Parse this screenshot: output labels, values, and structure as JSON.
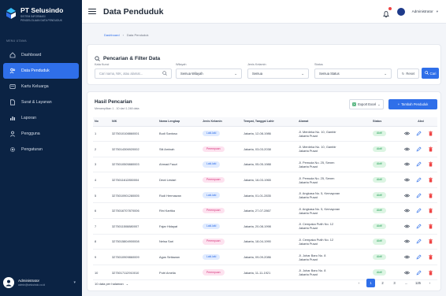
{
  "brand": {
    "title": "PT Selusindo",
    "subtitle_1": "SISTEM INFORMASI",
    "subtitle_2": "PENGELOLAAN DATA PENDUDUK"
  },
  "sidebar": {
    "section": "MENU UTAMA",
    "items": [
      {
        "label": "Dashboard",
        "icon": "home-icon"
      },
      {
        "label": "Data Penduduk",
        "icon": "users-icon"
      },
      {
        "label": "Kartu Keluarga",
        "icon": "card-icon"
      },
      {
        "label": "Surat & Layanan",
        "icon": "document-icon"
      },
      {
        "label": "Laporan",
        "icon": "bar-chart-icon"
      },
      {
        "label": "Pengguna",
        "icon": "user-icon"
      },
      {
        "label": "Pengaturan",
        "icon": "gear-icon"
      }
    ],
    "user_name": "Administrator",
    "user_email": "admin@selusindo.co.id"
  },
  "topbar": {
    "title": "Data Penduduk",
    "admin_label": "Administrator"
  },
  "breadcrumb": {
    "home": "Dashboard",
    "sep": "›",
    "current": "Data Penduduk"
  },
  "filter": {
    "title": "Pencarian & Filter Data",
    "label_search": "Kata Kunci",
    "label_wilayah": "Wilayah",
    "label_gender": "Jenis Kelamin",
    "label_status": "Status",
    "search_placeholder": "Cari nama, NIK, atau alamat...",
    "wilayah_value": "Semua Wilayah",
    "gender_value": "Semua",
    "status_value": "Semua Status",
    "reset_label": "Reset",
    "cari_label": "Cari"
  },
  "results": {
    "title": "Hasil Pencarian",
    "subtitle": "Menampilkan 1 - 10 dari 1.248 data",
    "export_label": "Export Excel",
    "add_label": "Tambah Penduduk",
    "columns": [
      "No",
      "NIK",
      "Nama Lengkap",
      "Jenis Kelamin",
      "Tempat, Tanggal Lahir",
      "Alamat",
      "Status",
      "Aksi"
    ],
    "rows": [
      {
        "no": "1",
        "nik": "3275010108860001",
        "nama": "Budi Santoso",
        "jk": "Laki-laki",
        "g": "m",
        "ttl": "Jakarta, 12-08-1986",
        "alamat1": "Jl. Merdeka No. 10, Gambir",
        "alamat2": "Jakarta Pusat",
        "status": "Aktif"
      },
      {
        "no": "2",
        "nik": "3275014306920002",
        "nama": "Siti Aminah",
        "jk": "Perempuan",
        "g": "f",
        "ttl": "Jakarta, 03-03-2038",
        "alamat1": "Jl. Merdeka No. 10, Gambir",
        "alamat2": "Jakarta Pusat",
        "status": "Aktif"
      },
      {
        "no": "3",
        "nik": "3275010505880003",
        "nama": "Ahmad Fauzi",
        "jk": "Laki-laki",
        "g": "m",
        "ttl": "Jakarta, 05-05-1988",
        "alamat1": "Jl. Pemuda No. 25, Senen",
        "alamat2": "Jakarta Pusat",
        "status": "Aktif"
      },
      {
        "no": "4",
        "nik": "3275011612850004",
        "nama": "Dewi Lestari",
        "jk": "Perempuan",
        "g": "f",
        "ttl": "Jakarta, 16-03-1965",
        "alamat1": "Jl. Pemuda No. 25, Senen",
        "alamat2": "Jakarta Pusat",
        "status": "Aktif"
      },
      {
        "no": "5",
        "nik": "3275010901280005",
        "nama": "Rudi Hermawan",
        "jk": "Laki-laki",
        "g": "m",
        "ttl": "Jakarta, 01-01-2835",
        "alamat1": "Jl. Angkasa No. 5, Kemayoran",
        "alamat2": "Jakarta Pusat",
        "status": "Aktif"
      },
      {
        "no": "6",
        "nik": "3275016707870006",
        "nama": "Rini Kartika",
        "jk": "Perempuan",
        "g": "f",
        "ttl": "Jakarta, 27-07-2867",
        "alamat1": "Jl. Angkasa No. 5, Kemayoran",
        "alamat2": "Jakarta Pusat",
        "status": "Aktif"
      },
      {
        "no": "7",
        "nik": "3275011508880007",
        "nama": "Fajar Hidayat",
        "jk": "Laki-laki",
        "g": "m",
        "ttl": "Jakarta, 20-08-1998",
        "alamat1": "Jl. Cempaka Putih No. 12",
        "alamat2": "Jakarta Pusat",
        "status": "Aktif"
      },
      {
        "no": "8",
        "nik": "3275015804900008",
        "nama": "Nelsa Sari",
        "jk": "Perempuan",
        "g": "f",
        "ttl": "Jakarta, 18-04-1990",
        "alamat1": "Jl. Cempaka Putih No. 12",
        "alamat2": "Jakarta Pusat",
        "status": "Aktif"
      },
      {
        "no": "9",
        "nik": "3275010909860009",
        "nama": "Agus Setiawan",
        "jk": "Laki-laki",
        "g": "m",
        "ttl": "Jakarta, 09-09-2086",
        "alamat1": "Jl. Johar Baru No. 8",
        "alamat2": "Jakarta Pusat",
        "status": "Aktif"
      },
      {
        "no": "10",
        "nik": "3275017112910010",
        "nama": "Putri Amelia",
        "jk": "Perempuan",
        "g": "f",
        "ttl": "Jakarta, 11-11-1921",
        "alamat1": "Jl. Johar Baru No. 8",
        "alamat2": "Jakarta Pusat",
        "status": "Aktif"
      }
    ],
    "page_size": "10 data per halaman",
    "pages": [
      "‹",
      "1",
      "2",
      "3",
      "...",
      "125",
      "›"
    ],
    "active_page": "1"
  },
  "colors": {
    "sidebar_bg": "#0b2344",
    "accent": "#2f6fe9",
    "danger": "#ef4444",
    "success": "#1f9d55"
  }
}
